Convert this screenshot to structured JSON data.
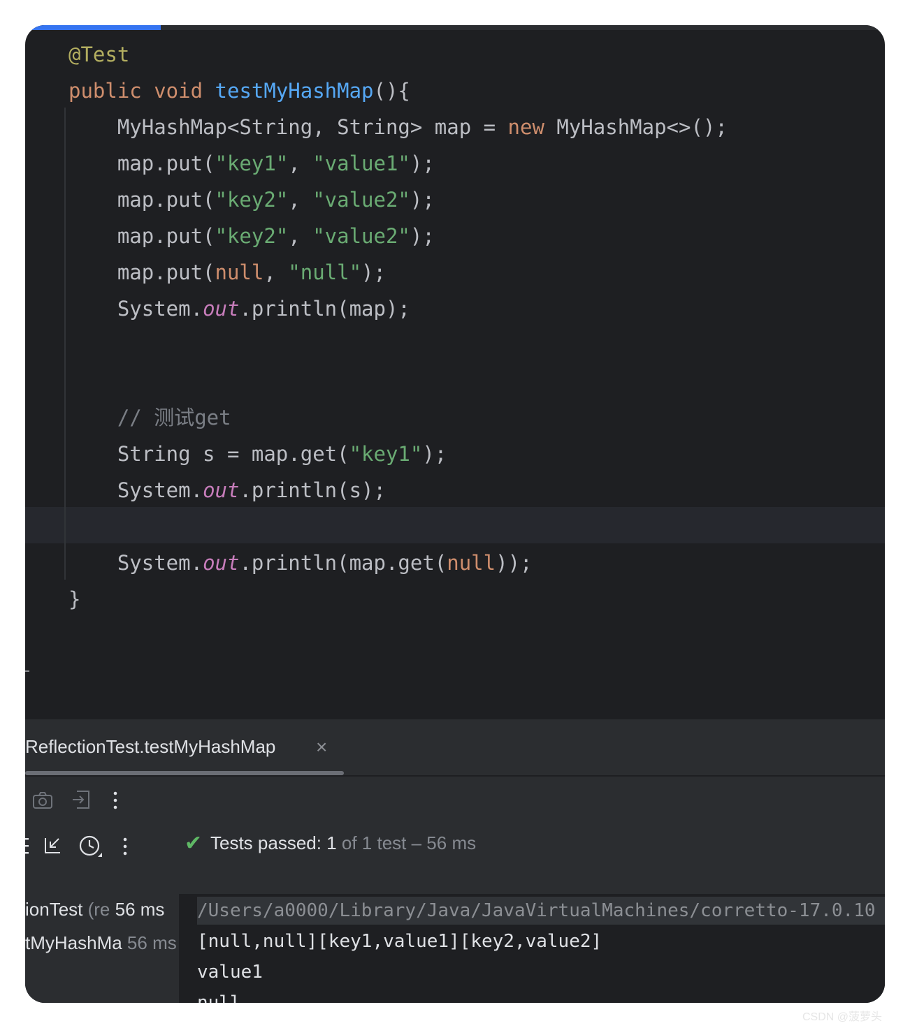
{
  "editor": {
    "lines": [
      {
        "tokens": [
          {
            "t": "@Test",
            "c": "t-ann"
          }
        ]
      },
      {
        "tokens": [
          {
            "t": "public ",
            "c": "t-kw"
          },
          {
            "t": "void ",
            "c": "t-kw"
          },
          {
            "t": "testMyHashMap",
            "c": "t-fn"
          },
          {
            "t": "(){",
            "c": ""
          }
        ]
      },
      {
        "tokens": [
          {
            "t": "    MyHashMap<String, String> map = ",
            "c": ""
          },
          {
            "t": "new ",
            "c": "t-kw"
          },
          {
            "t": "MyHashMap<>();",
            "c": ""
          }
        ]
      },
      {
        "tokens": [
          {
            "t": "    map.put(",
            "c": ""
          },
          {
            "t": "\"key1\"",
            "c": "t-str"
          },
          {
            "t": ", ",
            "c": ""
          },
          {
            "t": "\"value1\"",
            "c": "t-str"
          },
          {
            "t": ");",
            "c": ""
          }
        ]
      },
      {
        "tokens": [
          {
            "t": "    map.put(",
            "c": ""
          },
          {
            "t": "\"key2\"",
            "c": "t-str"
          },
          {
            "t": ", ",
            "c": ""
          },
          {
            "t": "\"value2\"",
            "c": "t-str"
          },
          {
            "t": ");",
            "c": ""
          }
        ]
      },
      {
        "tokens": [
          {
            "t": "    map.put(",
            "c": ""
          },
          {
            "t": "\"key2\"",
            "c": "t-str"
          },
          {
            "t": ", ",
            "c": ""
          },
          {
            "t": "\"value2\"",
            "c": "t-str"
          },
          {
            "t": ");",
            "c": ""
          }
        ]
      },
      {
        "tokens": [
          {
            "t": "    map.put(",
            "c": ""
          },
          {
            "t": "null",
            "c": "t-kw"
          },
          {
            "t": ", ",
            "c": ""
          },
          {
            "t": "\"null\"",
            "c": "t-str"
          },
          {
            "t": ");",
            "c": ""
          }
        ]
      },
      {
        "tokens": [
          {
            "t": "    System.",
            "c": ""
          },
          {
            "t": "out",
            "c": "t-fld"
          },
          {
            "t": ".println(map);",
            "c": ""
          }
        ]
      },
      {
        "tokens": []
      },
      {
        "tokens": []
      },
      {
        "tokens": [
          {
            "t": "    // 测试get",
            "c": "t-cmt"
          }
        ]
      },
      {
        "tokens": [
          {
            "t": "    String s = map.get(",
            "c": ""
          },
          {
            "t": "\"key1\"",
            "c": "t-str"
          },
          {
            "t": ");",
            "c": ""
          }
        ]
      },
      {
        "tokens": [
          {
            "t": "    System.",
            "c": ""
          },
          {
            "t": "out",
            "c": "t-fld"
          },
          {
            "t": ".println(s);",
            "c": ""
          }
        ]
      },
      {
        "tokens": []
      },
      {
        "tokens": [
          {
            "t": "    System.",
            "c": ""
          },
          {
            "t": "out",
            "c": "t-fld"
          },
          {
            "t": ".println(map.get(",
            "c": ""
          },
          {
            "t": "null",
            "c": "t-kw"
          },
          {
            "t": "));",
            "c": ""
          }
        ]
      },
      {
        "tokens": [
          {
            "t": "}",
            "c": ""
          }
        ]
      }
    ]
  },
  "run_panel": {
    "tab_title": "ReflectionTest.testMyHashMap",
    "tab_close": "×",
    "toolbar_icons": [
      "camera-icon",
      "exit-icon",
      "more-vertical-icon"
    ],
    "test_toolbar_icons": [
      "list-icon",
      "collapse-arrow-icon",
      "history-icon",
      "more-vertical-icon"
    ],
    "status": {
      "label": "Tests passed: ",
      "count": "1",
      "rest": " of 1 test – 56 ms"
    },
    "tree": [
      {
        "name": "ionTest",
        "dim": " (re",
        "time": " 56 ms"
      },
      {
        "name": "tMyHashMa",
        "dim": "",
        "time": " 56 ms"
      }
    ],
    "console": {
      "command": "/Users/a0000/Library/Java/JavaVirtualMachines/corretto-17.0.10",
      "output": [
        "[null,null][key1,value1][key2,value2]",
        "value1",
        "null"
      ]
    }
  },
  "watermark": "CSDN @菠萝头"
}
